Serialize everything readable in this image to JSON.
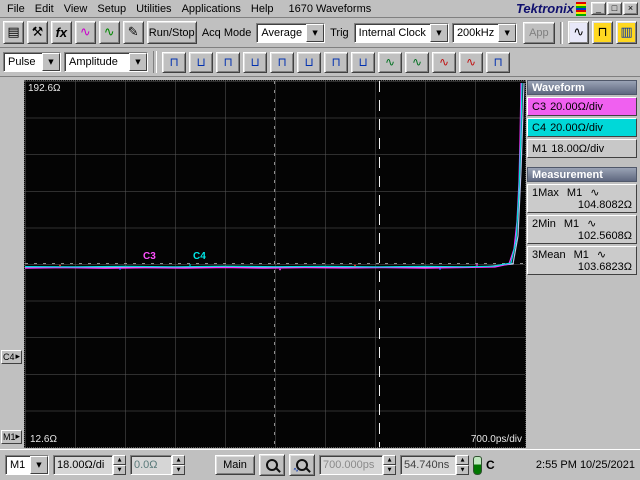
{
  "ui": {
    "dropdown": "▼",
    "spin_up": "▲",
    "spin_down": "▼",
    "arrow_right": "▸"
  },
  "window": {
    "menu": [
      "File",
      "Edit",
      "View",
      "Setup",
      "Utilities",
      "Applications",
      "Help"
    ],
    "title": "1670 Waveforms",
    "brand": "Tektronix",
    "minimize": "_",
    "maximize": "□",
    "close": "×"
  },
  "toolbar1": {
    "printer_icon": "▤",
    "tools_icon": "⚒",
    "fx_icon": "fx",
    "wave_magenta_icon": "∿",
    "wave_green_icon": "∿",
    "pencil_icon": "✎",
    "run_stop": "Run/Stop",
    "acq_mode_label": "Acq Mode",
    "acq_mode_value": "Average",
    "trig_label": "Trig",
    "trig_value": "Internal Clock",
    "rate_value": "200kHz",
    "app": "App",
    "display1_icon": "∿",
    "display2_icon": "⊓",
    "display3_icon": "▥"
  },
  "toolbar2": {
    "pulse": "Pulse",
    "amplitude": "Amplitude",
    "icons": [
      {
        "glyph": "⊓"
      },
      {
        "glyph": "⊔"
      },
      {
        "glyph": "⊓"
      },
      {
        "glyph": "⊔"
      },
      {
        "glyph": "⊓"
      },
      {
        "glyph": "⊔"
      },
      {
        "glyph": "⊓"
      },
      {
        "glyph": "⊔"
      },
      {
        "glyph": "∿"
      },
      {
        "glyph": "∿"
      },
      {
        "glyph": "∿"
      },
      {
        "glyph": "∿"
      },
      {
        "glyph": "⊓"
      }
    ]
  },
  "plot": {
    "top_label": "192.6Ω",
    "bottom_label": "12.6Ω",
    "timebase": "700.0ps/div",
    "c3_label": "C3",
    "c4_label": "C4",
    "marker_c4": "C4",
    "marker_m1": "M1"
  },
  "sidebar": {
    "waveform_header": "Waveform",
    "waveforms": [
      {
        "name": "C3",
        "scale": "20.00Ω/div",
        "color": "#f060f0"
      },
      {
        "name": "C4",
        "scale": "20.00Ω/div",
        "color": "#00d8d8"
      },
      {
        "name": "M1",
        "scale": "18.00Ω/div",
        "color": "#c8c8c8"
      }
    ],
    "measurement_header": "Measurement",
    "measurements": [
      {
        "label": "1Max",
        "source": "M1",
        "icon": "∿",
        "value": "104.8082Ω"
      },
      {
        "label": "2Min",
        "source": "M1",
        "icon": "∿",
        "value": "102.5608Ω"
      },
      {
        "label": "3Mean",
        "source": "M1",
        "icon": "∿",
        "value": "103.6823Ω"
      }
    ]
  },
  "statusbar": {
    "channel": "M1",
    "vscale": "18.00Ω/di",
    "offset": "0.0Ω",
    "main": "Main",
    "hscale": "700.000ps",
    "delay": "54.740ns",
    "temp_label": "C",
    "clock": "2:55 PM 10/25/2021"
  }
}
